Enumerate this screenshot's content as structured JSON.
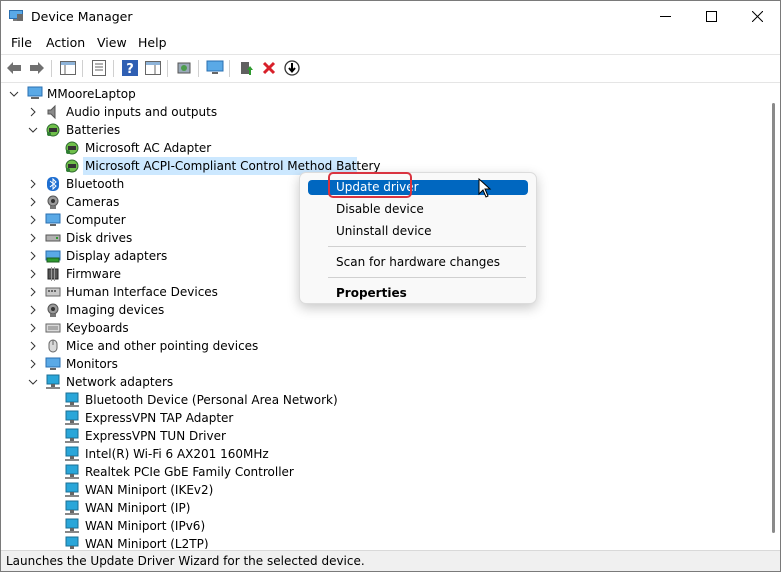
{
  "window": {
    "title": "Device Manager"
  },
  "menu": {
    "file": "File",
    "action": "Action",
    "view": "View",
    "help": "Help"
  },
  "tree": {
    "root": "MMooreLaptop",
    "rows": [
      {
        "label": "Audio inputs and outputs",
        "icon": "speaker-icon"
      },
      {
        "label": "Batteries",
        "icon": "battery-icon"
      },
      {
        "label": "Microsoft AC Adapter",
        "icon": "battery-icon"
      },
      {
        "label": "Microsoft ACPI-Compliant Control Method Battery",
        "icon": "battery-icon"
      },
      {
        "label": "Bluetooth",
        "icon": "bluetooth-icon"
      },
      {
        "label": "Cameras",
        "icon": "camera-icon"
      },
      {
        "label": "Computer",
        "icon": "monitor-icon"
      },
      {
        "label": "Disk drives",
        "icon": "disk-icon"
      },
      {
        "label": "Display adapters",
        "icon": "display-adapter-icon"
      },
      {
        "label": "Firmware",
        "icon": "chip-icon"
      },
      {
        "label": "Human Interface Devices",
        "icon": "hid-icon"
      },
      {
        "label": "Imaging devices",
        "icon": "camera-icon"
      },
      {
        "label": "Keyboards",
        "icon": "keyboard-icon"
      },
      {
        "label": "Mice and other pointing devices",
        "icon": "mouse-icon"
      },
      {
        "label": "Monitors",
        "icon": "monitor-icon"
      },
      {
        "label": "Network adapters",
        "icon": "network-icon"
      },
      {
        "label": "Bluetooth Device (Personal Area Network)",
        "icon": "network-icon"
      },
      {
        "label": "ExpressVPN TAP Adapter",
        "icon": "network-icon"
      },
      {
        "label": "ExpressVPN TUN Driver",
        "icon": "network-icon"
      },
      {
        "label": "Intel(R) Wi-Fi 6 AX201 160MHz",
        "icon": "network-icon"
      },
      {
        "label": "Realtek PCIe GbE Family Controller",
        "icon": "network-icon"
      },
      {
        "label": "WAN Miniport (IKEv2)",
        "icon": "network-icon"
      },
      {
        "label": "WAN Miniport (IP)",
        "icon": "network-icon"
      },
      {
        "label": "WAN Miniport (IPv6)",
        "icon": "network-icon"
      },
      {
        "label": "WAN Miniport (L2TP)",
        "icon": "network-icon"
      }
    ]
  },
  "context_menu": {
    "update_driver": "Update driver",
    "disable_device": "Disable device",
    "uninstall_device": "Uninstall device",
    "scan_hardware": "Scan for hardware changes",
    "properties": "Properties"
  },
  "status": {
    "text": "Launches the Update Driver Wizard for the selected device."
  },
  "colors": {
    "selection": "#cce8ff",
    "menu_highlight": "#0067c0",
    "annotation_red": "#d9333f"
  }
}
